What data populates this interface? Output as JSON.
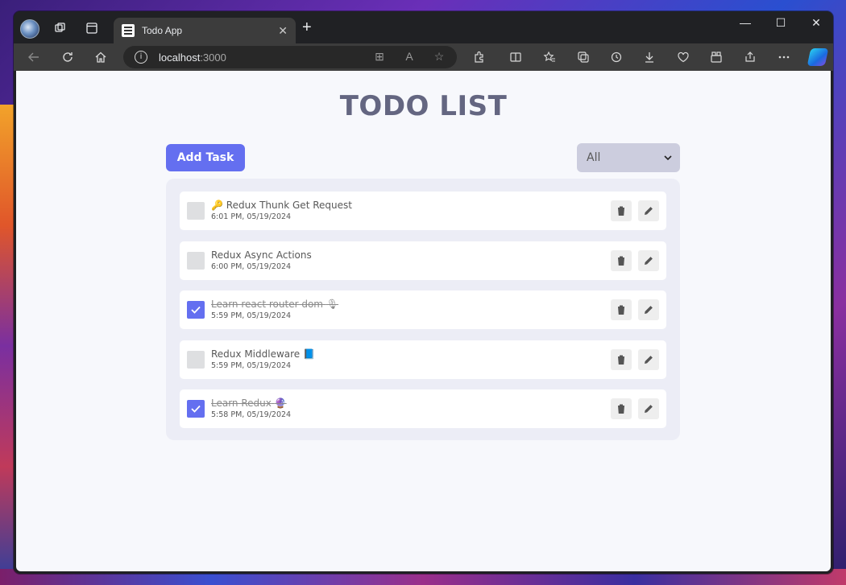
{
  "browser": {
    "tab_title": "Todo App",
    "tab_close": "✕",
    "new_tab": "+",
    "url_host": "localhost",
    "url_port": ":3000",
    "window_controls": {
      "minimize": "—",
      "maximize": "☐",
      "close": "✕"
    }
  },
  "app": {
    "title": "TODO LIST",
    "add_button": "Add Task",
    "filter": {
      "selected": "All"
    },
    "tasks": [
      {
        "emoji": "🔑",
        "title": "Redux Thunk Get Request",
        "time": "6:01 PM, 05/19/2024",
        "completed": false
      },
      {
        "emoji": "",
        "title": "Redux Async Actions",
        "time": "6:00 PM, 05/19/2024",
        "completed": false
      },
      {
        "emoji": "🎙",
        "title": "Learn react router dom",
        "time": "5:59 PM, 05/19/2024",
        "completed": true
      },
      {
        "emoji": "📘",
        "title": "Redux Middleware",
        "time": "5:59 PM, 05/19/2024",
        "completed": false
      },
      {
        "emoji": "🔮",
        "title": "Learn Redux",
        "time": "5:58 PM, 05/19/2024",
        "completed": true
      }
    ]
  },
  "icons": {
    "profile": "profile-avatar-icon",
    "workspaces": "workspaces-icon",
    "tab_actions": "tab-actions-icon",
    "back": "back-arrow-icon",
    "refresh": "refresh-icon",
    "home": "home-icon",
    "delete": "trash-icon",
    "edit": "pencil-icon"
  },
  "colors": {
    "accent": "#646ff0",
    "title": "#646681",
    "list_bg": "#ecedf6",
    "checkbox_unchecked": "#dedfe1"
  }
}
